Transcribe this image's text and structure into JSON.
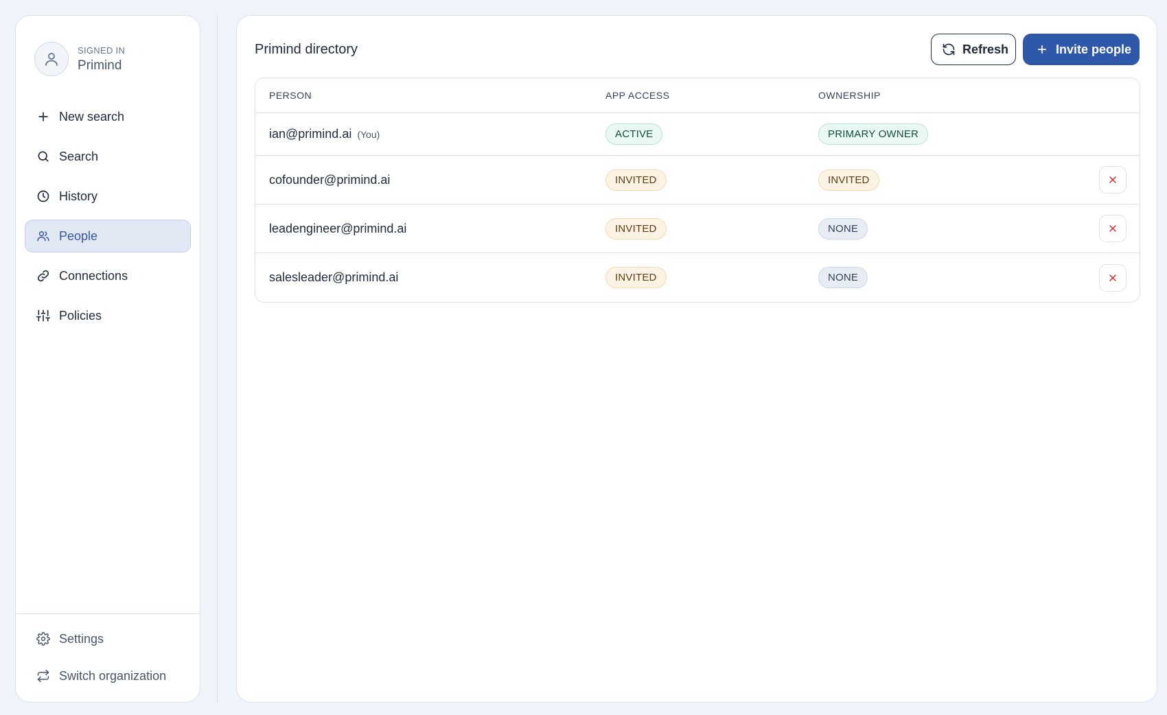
{
  "account": {
    "signed_in_label": "SIGNED IN",
    "org_name": "Primind",
    "icon": "user-icon"
  },
  "sidebar": {
    "items": [
      {
        "label": "New search",
        "icon": "plus-icon",
        "active": false
      },
      {
        "label": "Search",
        "icon": "search-icon",
        "active": false
      },
      {
        "label": "History",
        "icon": "clock-icon",
        "active": false
      },
      {
        "label": "People",
        "icon": "people-icon",
        "active": true
      },
      {
        "label": "Connections",
        "icon": "link-icon",
        "active": false
      },
      {
        "label": "Policies",
        "icon": "sliders-icon",
        "active": false
      }
    ],
    "bottom": [
      {
        "label": "Settings",
        "icon": "gear-icon"
      },
      {
        "label": "Switch organization",
        "icon": "swap-icon"
      }
    ]
  },
  "main": {
    "title": "Primind directory",
    "refresh_label": "Refresh",
    "invite_label": "Invite people"
  },
  "table": {
    "headers": [
      "PERSON",
      "APP ACCESS",
      "OWNERSHIP"
    ],
    "rows": [
      {
        "email": "ian@primind.ai",
        "you": "(You)",
        "access": "ACTIVE",
        "ownership": "PRIMARY OWNER",
        "removable": false
      },
      {
        "email": "cofounder@primind.ai",
        "you": "",
        "access": "INVITED",
        "ownership": "INVITED",
        "removable": true
      },
      {
        "email": "leadengineer@primind.ai",
        "you": "",
        "access": "INVITED",
        "ownership": "NONE",
        "removable": true
      },
      {
        "email": "salesleader@primind.ai",
        "you": "",
        "access": "INVITED",
        "ownership": "NONE",
        "removable": true
      }
    ]
  },
  "colors": {
    "accent": "#3058a8",
    "active_nav_bg": "#e1e8f3",
    "badge_active_bg": "#e9f8f1",
    "badge_invited_bg": "#fdf3e4",
    "badge_none_bg": "#e8edf5",
    "remove_icon": "#dc2626"
  }
}
